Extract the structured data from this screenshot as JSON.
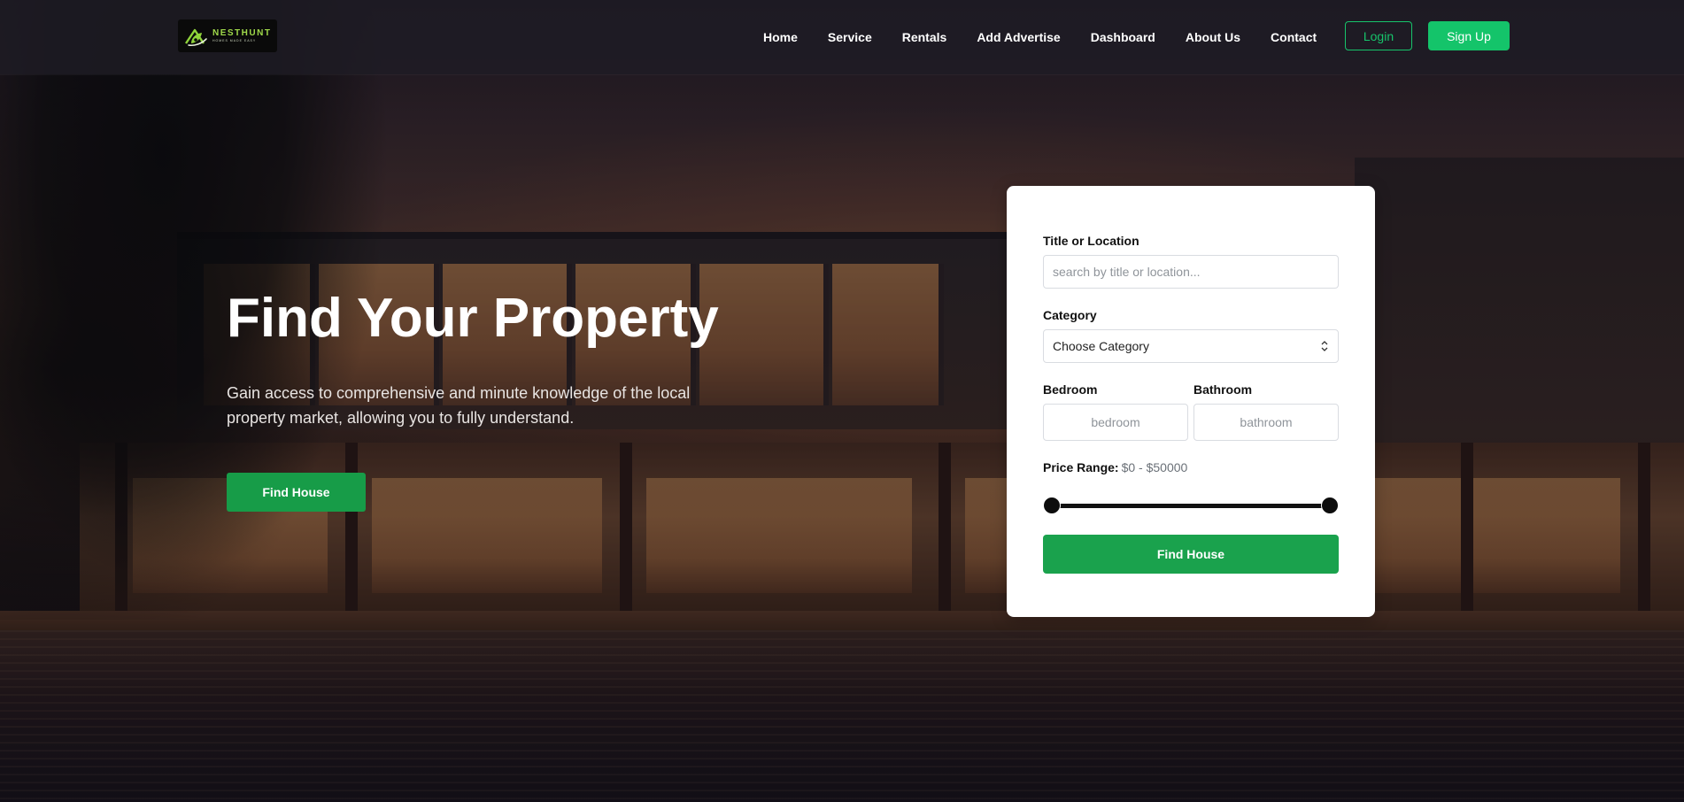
{
  "brand": {
    "logo_name": "NESTHUNT",
    "logo_tagline": "HOMES MADE EASY",
    "accent_color": "#14c46a",
    "button_color": "#1aa24d"
  },
  "nav": {
    "links": [
      "Home",
      "Service",
      "Rentals",
      "Add Advertise",
      "Dashboard",
      "About Us",
      "Contact"
    ],
    "login_label": "Login",
    "signup_label": "Sign Up"
  },
  "hero": {
    "title": "Find Your Property",
    "description": "Gain access to comprehensive and minute knowledge of the local property market, allowing you to fully understand.",
    "button_label": "Find House"
  },
  "search": {
    "title_label": "Title or Location",
    "title_placeholder": "search by title or location...",
    "title_value": "",
    "category_label": "Category",
    "category_selected": "Choose Category",
    "bedroom_label": "Bedroom",
    "bedroom_placeholder": "bedroom",
    "bathroom_label": "Bathroom",
    "bathroom_placeholder": "bathroom",
    "price_label": "Price Range:",
    "price_value": "$0 - $50000",
    "price_min": 0,
    "price_max": 50000,
    "price_selected_min": 0,
    "price_selected_max": 50000,
    "submit_label": "Find House"
  },
  "icons": {
    "logo": "house-leaf-logo-icon",
    "select_arrow": "chevron-up-down-icon"
  }
}
